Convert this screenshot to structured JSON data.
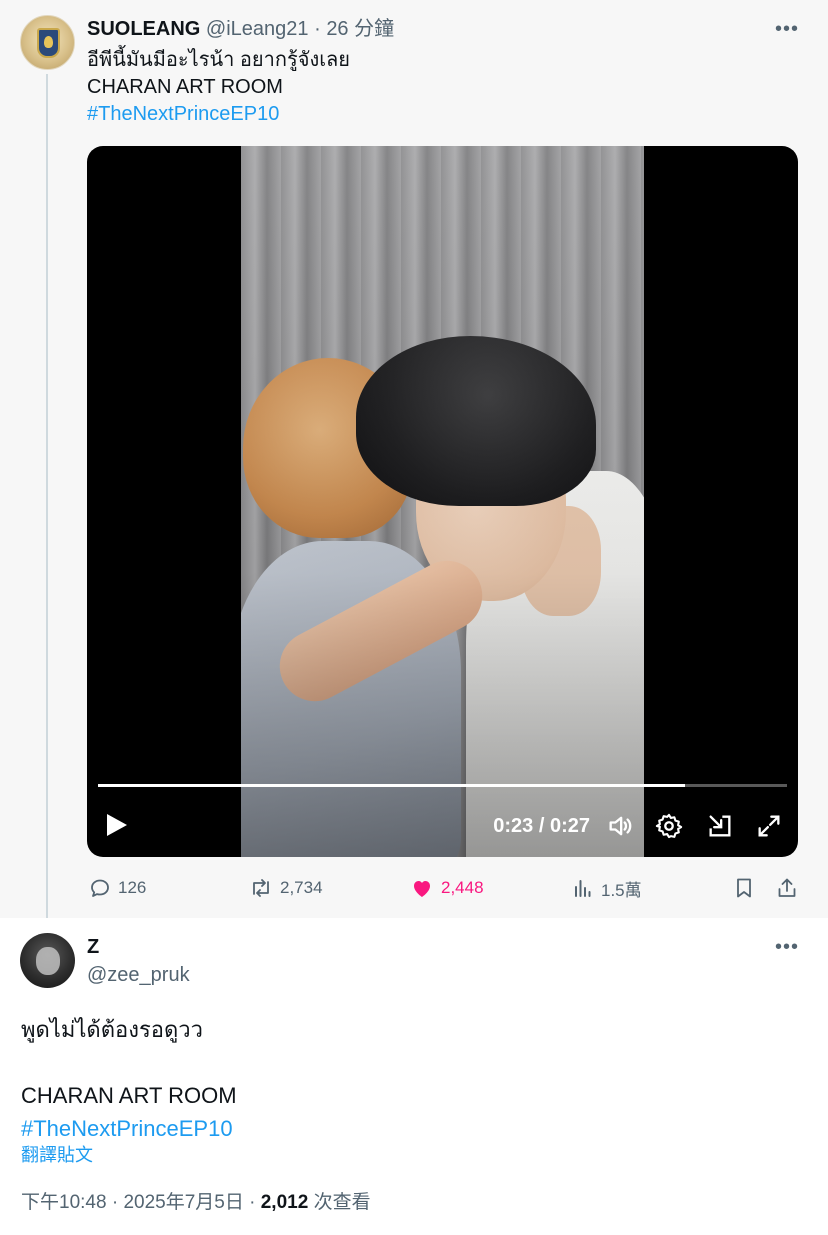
{
  "tweet1": {
    "display_name": "SUOLEANG",
    "handle": "@iLeang21",
    "separator": "·",
    "time": "26 分鐘",
    "more": "•••",
    "line1": "อีพีนี้มันมีอะไรน้า อยากรู้จังเลย",
    "line2": "CHARAN ART ROOM",
    "hashtag": "#TheNextPrinceEP10",
    "video": {
      "timecode": "0:23 / 0:27",
      "progress_fraction": 0.852
    },
    "actions": {
      "replies": "126",
      "reposts": "2,734",
      "likes": "2,448",
      "views": "1.5萬"
    },
    "colors": {
      "like": "#f91880",
      "link": "#1d9bf0",
      "muted": "#536471"
    }
  },
  "tweet2": {
    "display_name": "Z",
    "handle": "@zee_pruk",
    "more": "•••",
    "line1": "พูดไม่ได้ต้องรอดูวว",
    "line2": "",
    "line3": "CHARAN ART ROOM",
    "hashtag": "#TheNextPrinceEP10",
    "translate": "翻譯貼文",
    "time": "下午10:48",
    "sep": "·",
    "date": "2025年7月5日",
    "views_count": "2,012",
    "views_label": "次查看"
  }
}
